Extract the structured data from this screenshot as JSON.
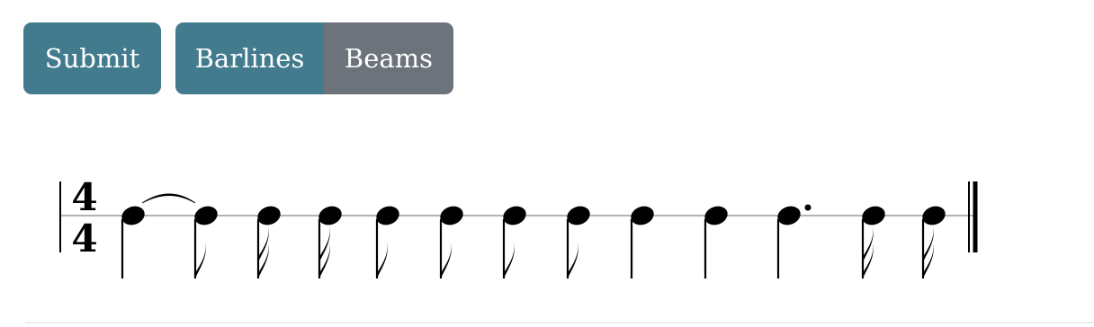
{
  "toolbar": {
    "submit_label": "Submit",
    "barlines_label": "Barlines",
    "beams_label": "Beams",
    "active_button": "Barlines"
  },
  "score": {
    "time_signature": {
      "numerator": "4",
      "denominator": "4"
    },
    "notes": [
      {
        "type": "quarter",
        "tie_to_next": true
      },
      {
        "type": "eighth"
      },
      {
        "type": "sixteenth"
      },
      {
        "type": "sixteenth"
      },
      {
        "type": "eighth"
      },
      {
        "type": "eighth"
      },
      {
        "type": "eighth"
      },
      {
        "type": "eighth"
      },
      {
        "type": "quarter"
      },
      {
        "type": "quarter"
      },
      {
        "type": "dotted-quarter"
      },
      {
        "type": "sixteenth"
      },
      {
        "type": "sixteenth"
      }
    ],
    "end_barline": "final-double"
  },
  "colors": {
    "primary": "#437b8e",
    "secondary": "#6c737b",
    "ink": "#000000",
    "staff_line": "#9a9a9a"
  }
}
